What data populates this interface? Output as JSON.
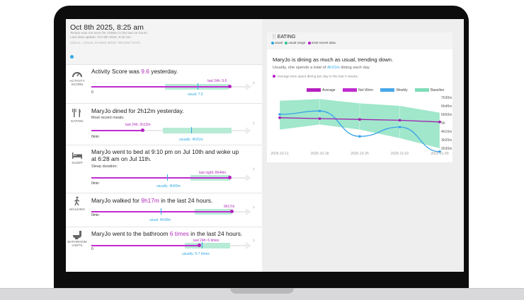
{
  "colors": {
    "purple": "#b51fc0",
    "blue": "#2ea8e2",
    "green": "#b7ebd6",
    "baseline": "#7fdcb8"
  },
  "header": {
    "date": "Oct 8th 2025, 8:25 am",
    "line1": "Tempo was not worn for 1h55m in the last 24 hours",
    "line2": "Last data update: Oct 8th 2025, 8:30 am",
    "line3": "USUAL, USUAL RANGE MOST RECENT DATA"
  },
  "cards": {
    "activity": {
      "icon": "speedometer-icon",
      "icon_label": "ACTIVITY SCORE",
      "title_pre": "Activity Score was ",
      "title_hl": "9.6",
      "title_post": " yesterday.",
      "zero": "0",
      "recent": "last 24h: 9.6",
      "usual": "usual: 7.5",
      "recent_fraction": 0.89,
      "usual_fraction": 0.72
    },
    "eating": {
      "icon": "utensils-icon",
      "icon_label": "EATING",
      "title": "MaryJo   dined for 2h12m yesterday.",
      "subtitle": "Most recent meals:",
      "zero": "0min",
      "recent": "last 24h: 2h12m",
      "usual": "usually: 4h31m",
      "recent_fraction": 0.35,
      "usual_fraction": 0.72
    },
    "sleep": {
      "icon": "bed-icon",
      "icon_label": "SLEEP",
      "title_line1": "MaryJo   went to bed at 9:10 pm on Jul 10th and woke up",
      "title_line2": "at 6:28 am on Jul 11th.",
      "subtitle": "Sleep duration:",
      "zero": "0min",
      "recent": "last night: 8h44m",
      "usual": "usually: 4h50m",
      "recent_fraction": 0.9,
      "usual_fraction": 0.5
    },
    "walking": {
      "icon": "walking-person-icon",
      "icon_label": "WALKING",
      "title_pre": "MaryJo   walked for ",
      "title_hl": "9h17m",
      "title_post": " in the last 24 hours.",
      "zero": "0min",
      "recent": "9h17m",
      "usual": "usual: 4h38m",
      "recent_fraction": 0.92,
      "usual_fraction": 0.46
    },
    "bathroom": {
      "icon": "toilet-icon",
      "icon_label": "BATHROOM VISITS",
      "title_pre": "MaryJo   went to the bathroom ",
      "title_hl": "6 times",
      "title_post": " in the last 24 hours.",
      "zero": "0",
      "recent": "last 24h: 6 times",
      "usual": "usually: 6-7 times",
      "recent_fraction": 0.77,
      "usual_fraction": 0.8
    }
  },
  "detail": {
    "icon": "utensils-icon",
    "title": "EATING",
    "legend_usual": "usual",
    "legend_range": "usual range",
    "legend_recent": "most recent data",
    "headline": "MaryJo is dining as much as usual, trending down.",
    "sub_pre": "Usually, she spends a total of ",
    "sub_hl": "4h31m",
    "sub_post": " dining each day",
    "caption": "Average time spent dining per day in the last 4 weeks:"
  },
  "chart_data": {
    "type": "line",
    "x": [
      "2025-10-11",
      "2025-10-18",
      "2025-10-25",
      "2025-11-02",
      "2025-11-09"
    ],
    "series": [
      {
        "name": "Average",
        "values": [
          "5h30m",
          "5h25m",
          "5h20m",
          "5h15m",
          "5h05m"
        ]
      },
      {
        "name": "Not Worn",
        "values": []
      },
      {
        "name": "Weekly",
        "values": [
          "5h50m",
          "6h10m",
          "3h40m",
          "4h35m",
          "2h10m"
        ]
      },
      {
        "name": "Baseline",
        "range": [
          [
            "4h20m",
            "7h10m"
          ],
          [
            "4h50m",
            "7h20m"
          ],
          [
            "4h20m",
            "6h55m"
          ],
          [
            "3h30m",
            "6h40m"
          ],
          [
            "2h30m",
            "6h00m"
          ]
        ]
      }
    ],
    "y_ticks": [
      "7h30m",
      "6h40m",
      "5h50m",
      "5h",
      "4h10m",
      "3h20m",
      "2h30m"
    ],
    "x_ticks": [
      "2025-10-11",
      "2025-10-18",
      "2025-10-25",
      "2025-11-02",
      "2025-11-09"
    ],
    "legend": "top"
  }
}
